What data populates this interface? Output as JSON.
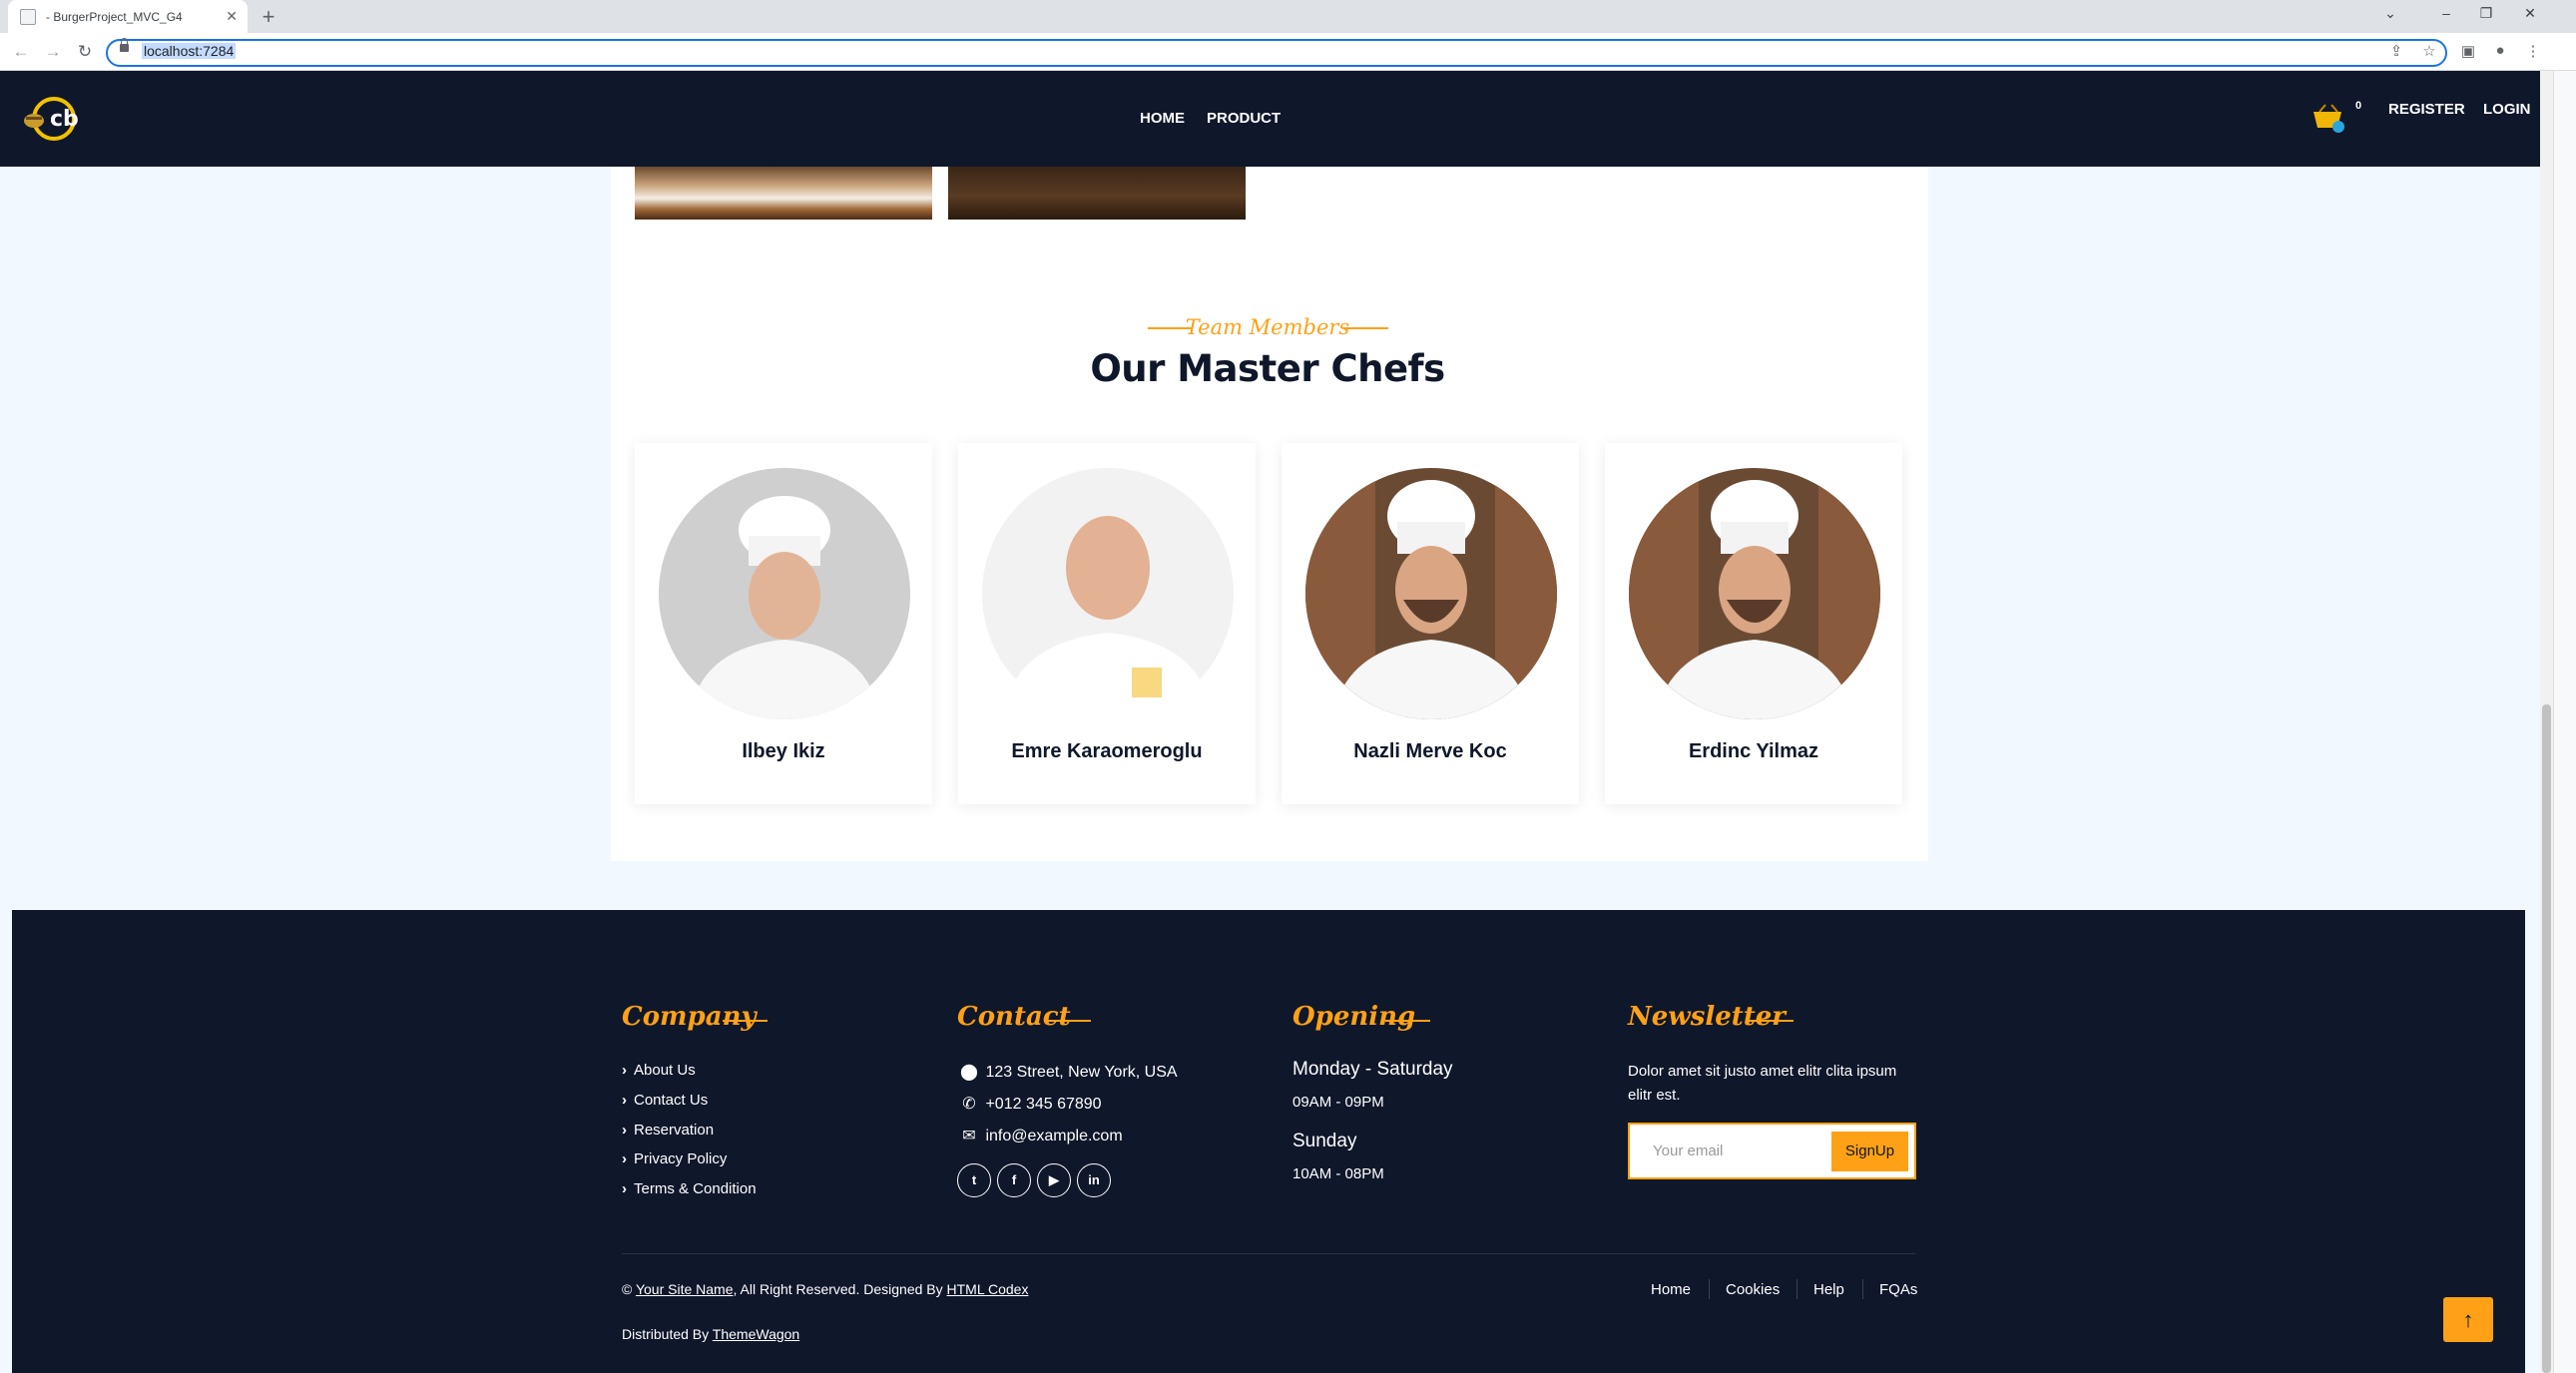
{
  "browser": {
    "tab_title": "- BurgerProject_MVC_G4",
    "tab_close": "✕",
    "new_tab": "+",
    "url": "localhost:7284"
  },
  "site": {
    "logo_text": "cb",
    "nav": {
      "home": "HOME",
      "product": "PRODUCT"
    },
    "cart_count": "0",
    "register": "REGISTER",
    "login": "LOGIN"
  },
  "team": {
    "subtitle": "Team Members",
    "title": "Our Master Chefs",
    "chefs": [
      {
        "name": "Ilbey Ikiz"
      },
      {
        "name": "Emre Karaomeroglu"
      },
      {
        "name": "Nazli Merve Koc"
      },
      {
        "name": "Erdinc Yilmaz"
      }
    ]
  },
  "footer": {
    "company": {
      "heading": "Company",
      "links": [
        "About Us",
        "Contact Us",
        "Reservation",
        "Privacy Policy",
        "Terms & Condition"
      ]
    },
    "contact": {
      "heading": "Contact",
      "address": "123 Street, New York, USA",
      "phone": "+012 345 67890",
      "email": "info@example.com",
      "social": [
        "twitter-icon",
        "facebook-icon",
        "youtube-icon",
        "linkedin-icon"
      ]
    },
    "opening": {
      "heading": "Opening",
      "day1": "Monday - Saturday",
      "time1": "09AM - 09PM",
      "day2": "Sunday",
      "time2": "10AM - 08PM"
    },
    "newsletter": {
      "heading": "Newsletter",
      "text": "Dolor amet sit justo amet elitr clita ipsum elitr est.",
      "placeholder": "Your email",
      "button": "SignUp"
    },
    "copyright": {
      "prefix": "©",
      "site_name": "Your Site Name",
      "middle": ", All Right Reserved. Designed By",
      "designer": "HTML Codex",
      "distributed_prefix": "Distributed By",
      "distributor": "ThemeWagon"
    },
    "bottom_links": [
      "Home",
      "Cookies",
      "Help",
      "FQAs"
    ]
  },
  "colors": {
    "accent": "#fea116",
    "dark": "#0f172b",
    "bg": "#f1f8ff"
  }
}
